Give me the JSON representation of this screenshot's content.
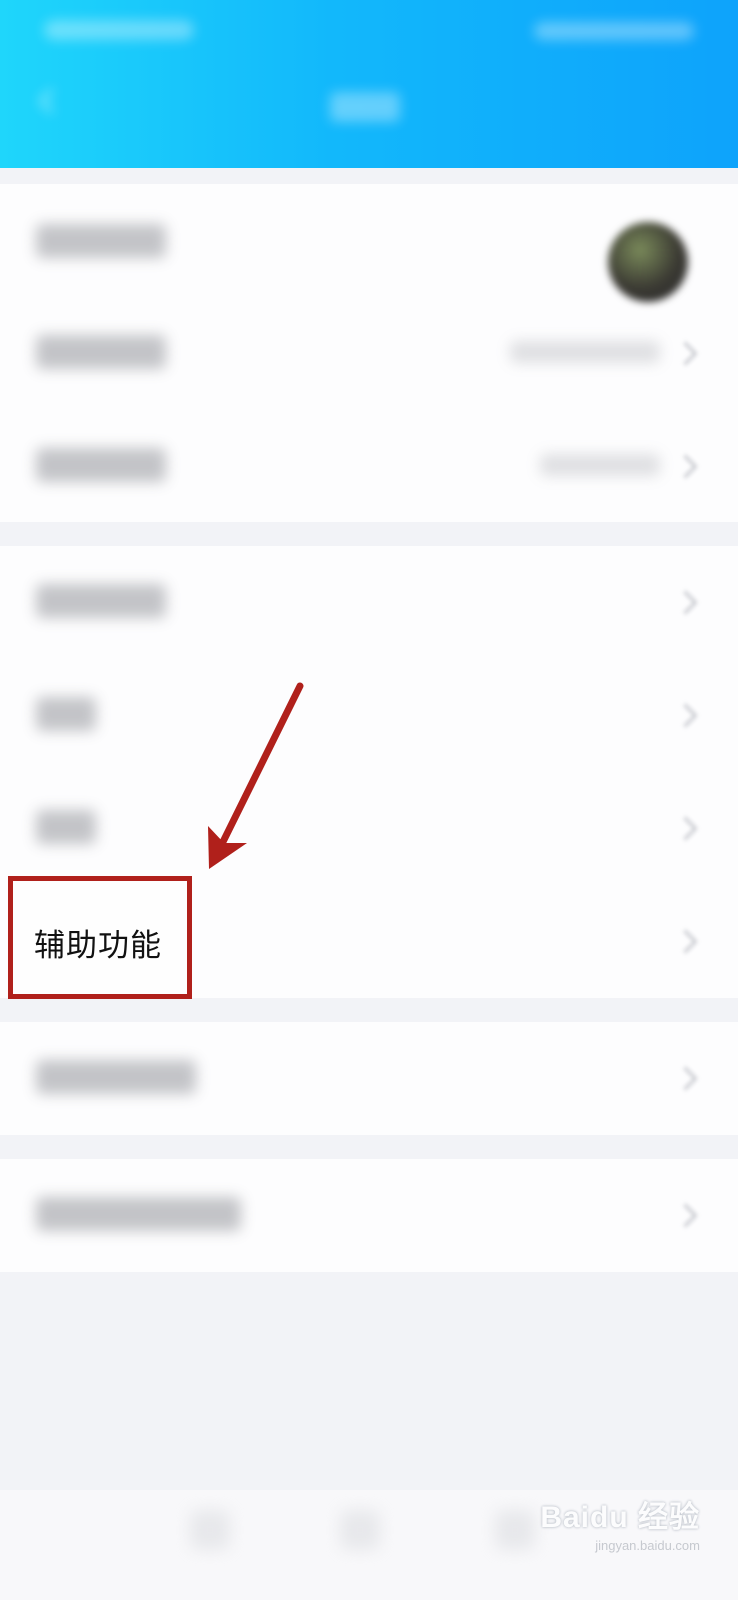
{
  "highlight": {
    "label": "辅助功能"
  },
  "watermark": {
    "brand": "Baidu 经验",
    "url": "jingyan.baidu.com"
  },
  "colors": {
    "header_gradient_start": "#1fd6fb",
    "header_gradient_end": "#0ea3fb",
    "annotation_red": "#b0201b",
    "background": "#f2f3f7"
  }
}
